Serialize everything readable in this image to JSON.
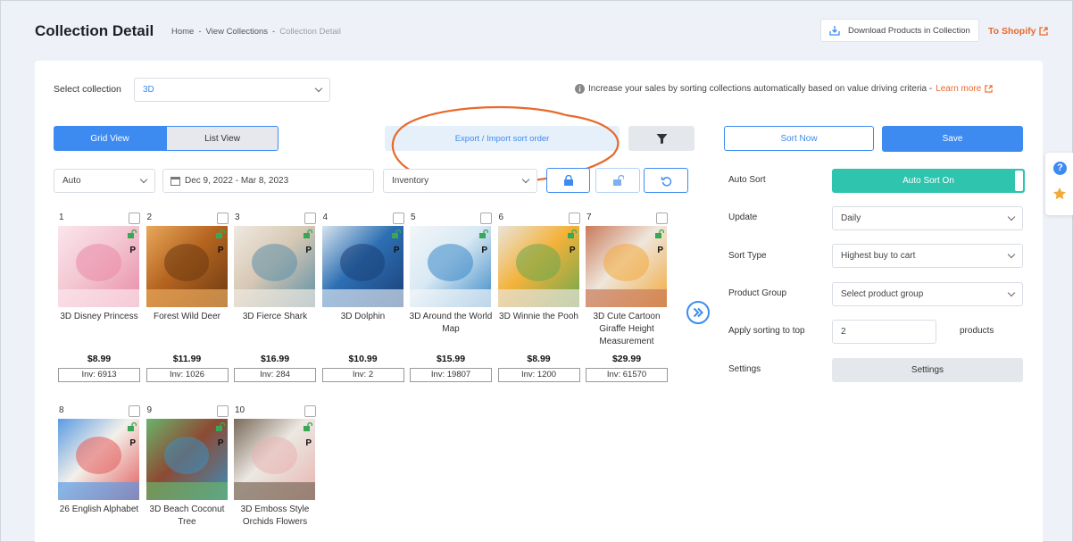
{
  "header": {
    "title": "Collection Detail",
    "breadcrumb": [
      "Home",
      "View Collections",
      "Collection Detail"
    ],
    "download_label": "Download Products in Collection",
    "to_shopify_label": "To Shopify"
  },
  "select_collection": {
    "label": "Select collection",
    "value": "3D"
  },
  "info_text": "Increase your sales by sorting collections automatically based on value driving criteria -",
  "learn_more": "Learn more",
  "views": {
    "grid": "Grid View",
    "list": "List View"
  },
  "export_label": "Export / Import sort order",
  "sort_now_label": "Sort Now",
  "save_label": "Save",
  "filters": {
    "auto": "Auto",
    "date_range": "Dec 9, 2022 - Mar 8, 2023",
    "metric": "Inventory"
  },
  "products": [
    {
      "num": "1",
      "name": "3D Disney Princess",
      "price": "$8.99",
      "inv": "Inv: 6913",
      "colors": [
        "#f3c7d3",
        "#e98ba7",
        "#fbe5ec"
      ]
    },
    {
      "num": "2",
      "name": "Forest Wild Deer",
      "price": "$11.99",
      "inv": "Inv: 1026",
      "colors": [
        "#b5641f",
        "#6b3a12",
        "#e8a85c"
      ]
    },
    {
      "num": "3",
      "name": "3D Fierce Shark",
      "price": "$16.99",
      "inv": "Inv: 284",
      "colors": [
        "#d7c8b4",
        "#5c8fa8",
        "#efe9e0"
      ]
    },
    {
      "num": "4",
      "name": "3D Dolphin",
      "price": "$10.99",
      "inv": "Inv: 2",
      "colors": [
        "#2d6fb3",
        "#1a3f77",
        "#d7e3ee"
      ]
    },
    {
      "num": "5",
      "name": "3D Around the World Map",
      "price": "$15.99",
      "inv": "Inv: 19807",
      "colors": [
        "#d9e9f3",
        "#3b89c7",
        "#f2f6f9"
      ]
    },
    {
      "num": "6",
      "name": "3D Winnie the Pooh",
      "price": "$8.99",
      "inv": "Inv: 1200",
      "colors": [
        "#f4b23a",
        "#6aa84f",
        "#e9e4dc"
      ]
    },
    {
      "num": "7",
      "name": "3D Cute Cartoon Giraffe Height Measurement",
      "price": "$29.99",
      "inv": "Inv: 61570",
      "colors": [
        "#efe6dc",
        "#f2a93b",
        "#c97a5a"
      ]
    },
    {
      "num": "8",
      "name": "26 English Alphabet",
      "price": "",
      "inv": "",
      "colors": [
        "#f3f0ea",
        "#e35b5b",
        "#5b9be3"
      ]
    },
    {
      "num": "9",
      "name": "3D Beach Coconut Tree",
      "price": "",
      "inv": "",
      "colors": [
        "#8d4a33",
        "#3a8fbf",
        "#6bb36b"
      ]
    },
    {
      "num": "10",
      "name": "3D Emboss Style Orchids Flowers",
      "price": "",
      "inv": "",
      "colors": [
        "#ece8e2",
        "#e7b3b0",
        "#7a6a5a"
      ]
    }
  ],
  "right": {
    "auto_sort_label": "Auto Sort",
    "auto_sort_value": "Auto Sort On",
    "update_label": "Update",
    "update_value": "Daily",
    "sort_type_label": "Sort Type",
    "sort_type_value": "Highest buy to cart",
    "product_group_label": "Product Group",
    "product_group_value": "Select product group",
    "apply_label": "Apply sorting to top",
    "apply_value": "2",
    "apply_suffix": "products",
    "settings_label": "Settings",
    "settings_button": "Settings"
  },
  "colors": {
    "accent": "#3d8bf0",
    "teal": "#2ec4ae",
    "orange": "#e8692c",
    "lock_green": "#3aa756"
  }
}
